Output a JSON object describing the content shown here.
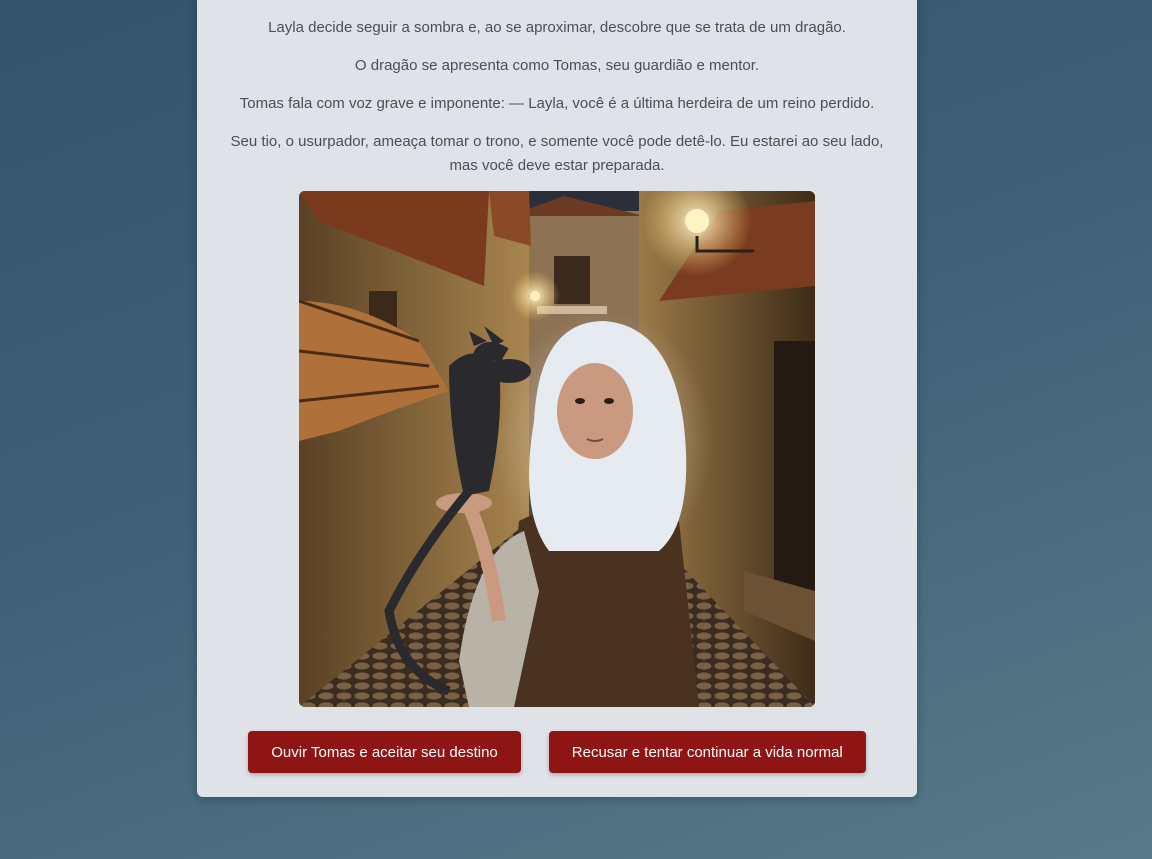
{
  "story": {
    "paragraphs": [
      "Layla decide seguir a sombra e, ao se aproximar, descobre que se trata de um dragão.",
      "O dragão se apresenta como Tomas, seu guardião e mentor.",
      "Tomas fala com voz grave e imponente: — Layla, você é a última herdeira de um reino perdido.",
      "Seu tio, o usurpador, ameaça tomar o trono, e somente você pode detê-lo. Eu estarei ao seu lado, mas você deve estar preparada."
    ]
  },
  "choices": {
    "accept_label": "Ouvir Tomas e aceitar seu destino",
    "refuse_label": "Recusar e tentar continuar a vida normal"
  },
  "colors": {
    "button_bg": "#8f1515",
    "card_bg": "#dfe3e8",
    "text": "#4a4f56"
  }
}
